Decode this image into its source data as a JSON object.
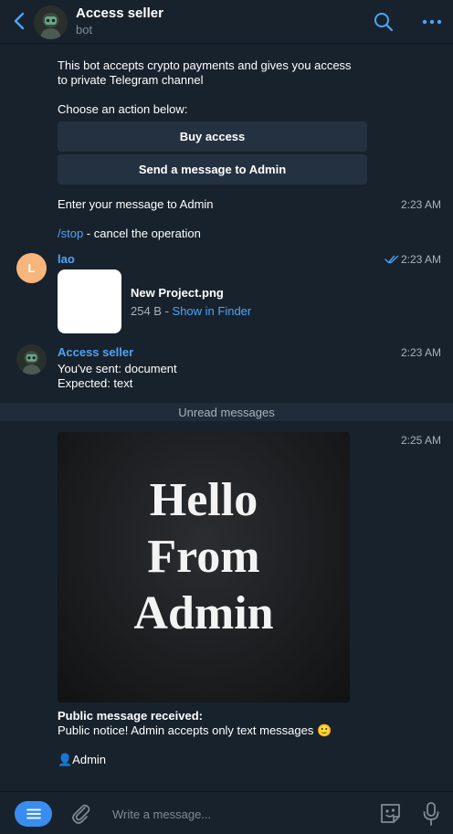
{
  "header": {
    "title": "Access seller",
    "subtitle": "bot",
    "icons": [
      "back-icon",
      "bot-avatar",
      "search-icon",
      "more-icon"
    ]
  },
  "messages": {
    "intro_line1": "This bot accepts crypto payments and gives you access",
    "intro_line2": "to private Telegram channel",
    "choose_action": "Choose an action below:",
    "buttons": {
      "buy_access": "Buy access",
      "send_message": "Send a message to Admin"
    },
    "enter_message": "Enter your message to Admin",
    "enter_message_time": "2:23 AM",
    "stop_command": "/stop",
    "stop_text": " - cancel the operation",
    "user": {
      "sender": "lao",
      "avatar_initial": "L",
      "time": "2:23 AM",
      "file_name": "New Project.png",
      "file_size": "254 B - ",
      "show_in_finder": "Show in Finder"
    },
    "bot_reply": {
      "sender": "Access seller",
      "time": "2:23 AM",
      "line1": "You've sent: document",
      "line2": "Expected: text"
    },
    "unread_label": "Unread messages",
    "admin_post": {
      "time": "2:25 AM",
      "image_text": [
        "Hello",
        "From",
        "Admin"
      ],
      "heading": "Public message received:",
      "body": "Public notice! Admin accepts only text messages 🙂",
      "signature": "👤Admin"
    }
  },
  "footer": {
    "placeholder": "Write a message..."
  },
  "colors": {
    "background": "#18222d",
    "button": "#243140",
    "accent": "#4ea4f6",
    "unread_bar": "#202c39",
    "lao_avatar": "#f8b57c"
  }
}
